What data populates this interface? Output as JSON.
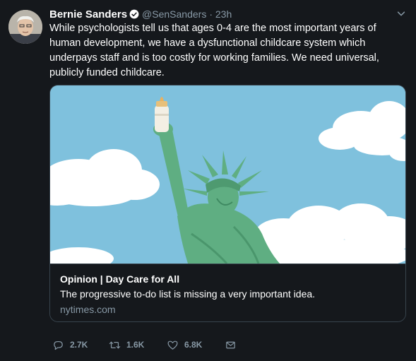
{
  "tweet": {
    "author_name": "Bernie Sanders",
    "handle": "@SenSanders",
    "time": "· 23h",
    "text": "While psychologists tell us that ages 0-4 are the most important years of human development, we have a dysfunctional childcare system which underpays staff and is too costly for working families. We need universal, publicly funded childcare."
  },
  "card": {
    "title": "Opinion | Day Care for All",
    "description": "The progressive to-do list is missing a very important idea.",
    "domain": "nytimes.com"
  },
  "actions": {
    "replies": "2.7K",
    "retweets": "1.6K",
    "likes": "6.8K"
  },
  "icons": [
    "verified-badge-icon",
    "chevron-down-icon",
    "reply-icon",
    "retweet-icon",
    "like-icon",
    "direct-message-icon"
  ],
  "colors": {
    "background": "#15181c",
    "muted": "#8899a6",
    "accent": "#1da1f2",
    "border": "#38444d"
  }
}
